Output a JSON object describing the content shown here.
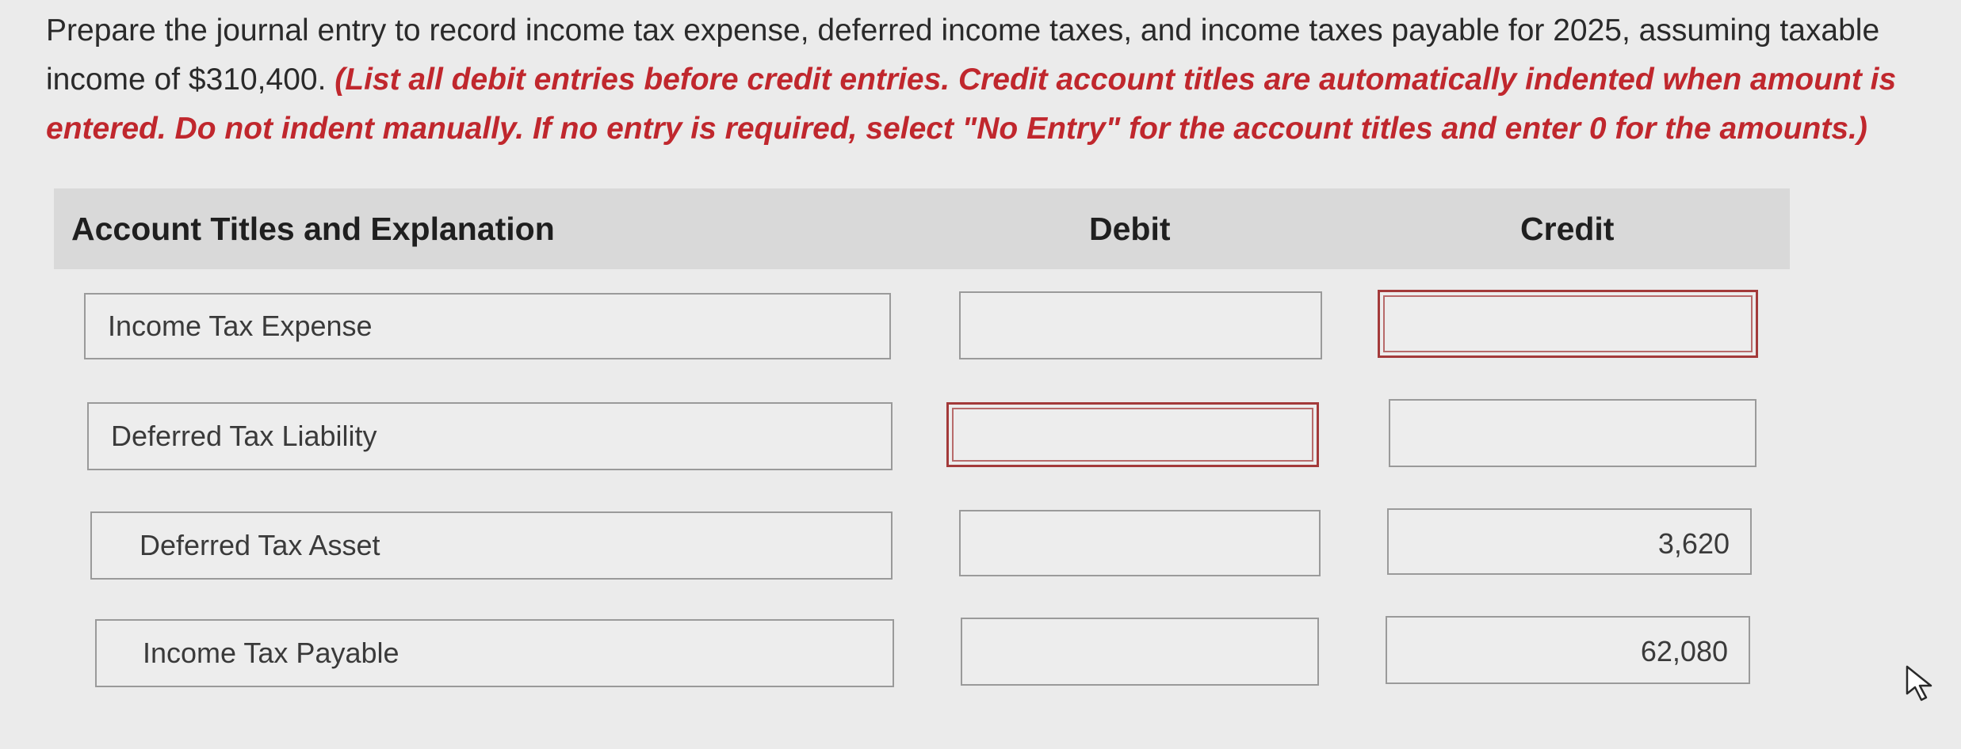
{
  "instructions": {
    "prompt": "Prepare the journal entry to record income tax expense, deferred income taxes, and income taxes payable for 2025, assuming taxable income of $310,400.",
    "emphasis": "(List all debit entries before credit entries. Credit account titles are automatically indented when amount is entered. Do not indent manually. If no entry is required, select \"No Entry\" for the account titles and enter 0 for the amounts.)"
  },
  "table": {
    "headers": {
      "account": "Account Titles and Explanation",
      "debit": "Debit",
      "credit": "Credit"
    },
    "rows": [
      {
        "account": "Income Tax Expense",
        "debit": "",
        "credit": ""
      },
      {
        "account": "Deferred Tax Liability",
        "debit": "",
        "credit": ""
      },
      {
        "account": "Deferred Tax Asset",
        "debit": "",
        "credit": "3,620"
      },
      {
        "account": "Income Tax Payable",
        "debit": "",
        "credit": "62,080"
      }
    ]
  },
  "colors": {
    "error_border": "#a33a3a",
    "emphasis_text": "#c0272d"
  },
  "icons": {
    "cursor": "mouse-pointer-icon"
  }
}
